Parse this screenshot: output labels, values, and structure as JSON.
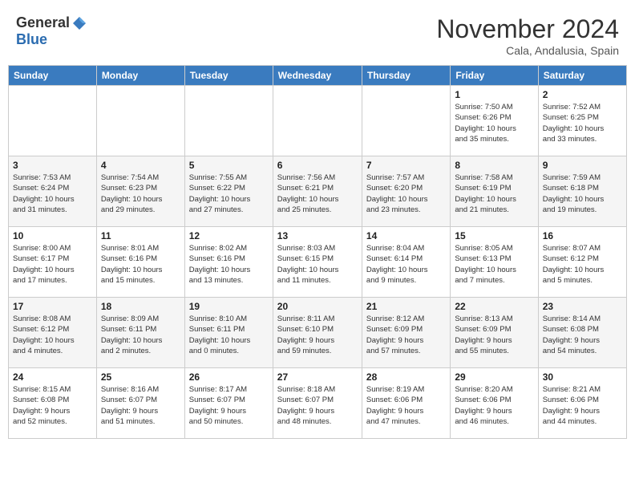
{
  "header": {
    "logo_general": "General",
    "logo_blue": "Blue",
    "month_title": "November 2024",
    "location": "Cala, Andalusia, Spain"
  },
  "weekdays": [
    "Sunday",
    "Monday",
    "Tuesday",
    "Wednesday",
    "Thursday",
    "Friday",
    "Saturday"
  ],
  "weeks": [
    [
      {
        "day": "",
        "info": ""
      },
      {
        "day": "",
        "info": ""
      },
      {
        "day": "",
        "info": ""
      },
      {
        "day": "",
        "info": ""
      },
      {
        "day": "",
        "info": ""
      },
      {
        "day": "1",
        "info": "Sunrise: 7:50 AM\nSunset: 6:26 PM\nDaylight: 10 hours\nand 35 minutes."
      },
      {
        "day": "2",
        "info": "Sunrise: 7:52 AM\nSunset: 6:25 PM\nDaylight: 10 hours\nand 33 minutes."
      }
    ],
    [
      {
        "day": "3",
        "info": "Sunrise: 7:53 AM\nSunset: 6:24 PM\nDaylight: 10 hours\nand 31 minutes."
      },
      {
        "day": "4",
        "info": "Sunrise: 7:54 AM\nSunset: 6:23 PM\nDaylight: 10 hours\nand 29 minutes."
      },
      {
        "day": "5",
        "info": "Sunrise: 7:55 AM\nSunset: 6:22 PM\nDaylight: 10 hours\nand 27 minutes."
      },
      {
        "day": "6",
        "info": "Sunrise: 7:56 AM\nSunset: 6:21 PM\nDaylight: 10 hours\nand 25 minutes."
      },
      {
        "day": "7",
        "info": "Sunrise: 7:57 AM\nSunset: 6:20 PM\nDaylight: 10 hours\nand 23 minutes."
      },
      {
        "day": "8",
        "info": "Sunrise: 7:58 AM\nSunset: 6:19 PM\nDaylight: 10 hours\nand 21 minutes."
      },
      {
        "day": "9",
        "info": "Sunrise: 7:59 AM\nSunset: 6:18 PM\nDaylight: 10 hours\nand 19 minutes."
      }
    ],
    [
      {
        "day": "10",
        "info": "Sunrise: 8:00 AM\nSunset: 6:17 PM\nDaylight: 10 hours\nand 17 minutes."
      },
      {
        "day": "11",
        "info": "Sunrise: 8:01 AM\nSunset: 6:16 PM\nDaylight: 10 hours\nand 15 minutes."
      },
      {
        "day": "12",
        "info": "Sunrise: 8:02 AM\nSunset: 6:16 PM\nDaylight: 10 hours\nand 13 minutes."
      },
      {
        "day": "13",
        "info": "Sunrise: 8:03 AM\nSunset: 6:15 PM\nDaylight: 10 hours\nand 11 minutes."
      },
      {
        "day": "14",
        "info": "Sunrise: 8:04 AM\nSunset: 6:14 PM\nDaylight: 10 hours\nand 9 minutes."
      },
      {
        "day": "15",
        "info": "Sunrise: 8:05 AM\nSunset: 6:13 PM\nDaylight: 10 hours\nand 7 minutes."
      },
      {
        "day": "16",
        "info": "Sunrise: 8:07 AM\nSunset: 6:12 PM\nDaylight: 10 hours\nand 5 minutes."
      }
    ],
    [
      {
        "day": "17",
        "info": "Sunrise: 8:08 AM\nSunset: 6:12 PM\nDaylight: 10 hours\nand 4 minutes."
      },
      {
        "day": "18",
        "info": "Sunrise: 8:09 AM\nSunset: 6:11 PM\nDaylight: 10 hours\nand 2 minutes."
      },
      {
        "day": "19",
        "info": "Sunrise: 8:10 AM\nSunset: 6:11 PM\nDaylight: 10 hours\nand 0 minutes."
      },
      {
        "day": "20",
        "info": "Sunrise: 8:11 AM\nSunset: 6:10 PM\nDaylight: 9 hours\nand 59 minutes."
      },
      {
        "day": "21",
        "info": "Sunrise: 8:12 AM\nSunset: 6:09 PM\nDaylight: 9 hours\nand 57 minutes."
      },
      {
        "day": "22",
        "info": "Sunrise: 8:13 AM\nSunset: 6:09 PM\nDaylight: 9 hours\nand 55 minutes."
      },
      {
        "day": "23",
        "info": "Sunrise: 8:14 AM\nSunset: 6:08 PM\nDaylight: 9 hours\nand 54 minutes."
      }
    ],
    [
      {
        "day": "24",
        "info": "Sunrise: 8:15 AM\nSunset: 6:08 PM\nDaylight: 9 hours\nand 52 minutes."
      },
      {
        "day": "25",
        "info": "Sunrise: 8:16 AM\nSunset: 6:07 PM\nDaylight: 9 hours\nand 51 minutes."
      },
      {
        "day": "26",
        "info": "Sunrise: 8:17 AM\nSunset: 6:07 PM\nDaylight: 9 hours\nand 50 minutes."
      },
      {
        "day": "27",
        "info": "Sunrise: 8:18 AM\nSunset: 6:07 PM\nDaylight: 9 hours\nand 48 minutes."
      },
      {
        "day": "28",
        "info": "Sunrise: 8:19 AM\nSunset: 6:06 PM\nDaylight: 9 hours\nand 47 minutes."
      },
      {
        "day": "29",
        "info": "Sunrise: 8:20 AM\nSunset: 6:06 PM\nDaylight: 9 hours\nand 46 minutes."
      },
      {
        "day": "30",
        "info": "Sunrise: 8:21 AM\nSunset: 6:06 PM\nDaylight: 9 hours\nand 44 minutes."
      }
    ]
  ]
}
